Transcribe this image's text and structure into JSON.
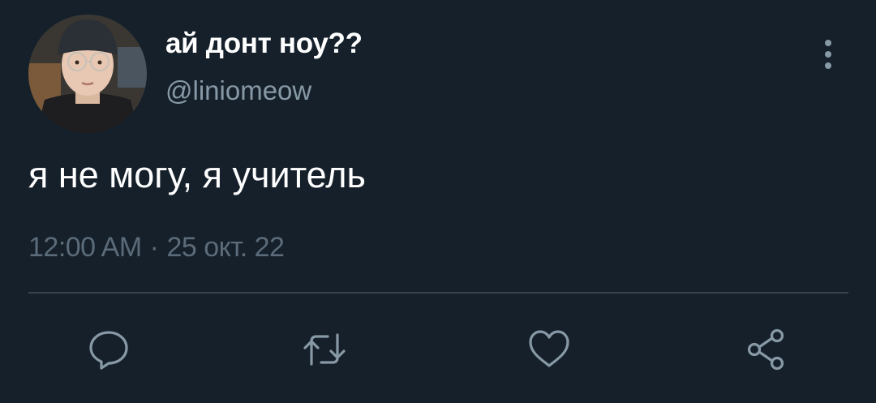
{
  "tweet": {
    "display_name": "ай донт ноу??",
    "handle": "@liniomeow",
    "text": "я не могу, я учитель",
    "time": "12:00 AM",
    "separator": "·",
    "date": "25 окт. 22"
  },
  "actions": [
    {
      "icon": "reply-icon"
    },
    {
      "icon": "retweet-icon"
    },
    {
      "icon": "like-icon"
    },
    {
      "icon": "share-icon"
    }
  ],
  "theme": {
    "background": "#15202b",
    "text_primary": "#ffffff",
    "text_secondary": "#8899a6",
    "divider": "#38444d"
  }
}
